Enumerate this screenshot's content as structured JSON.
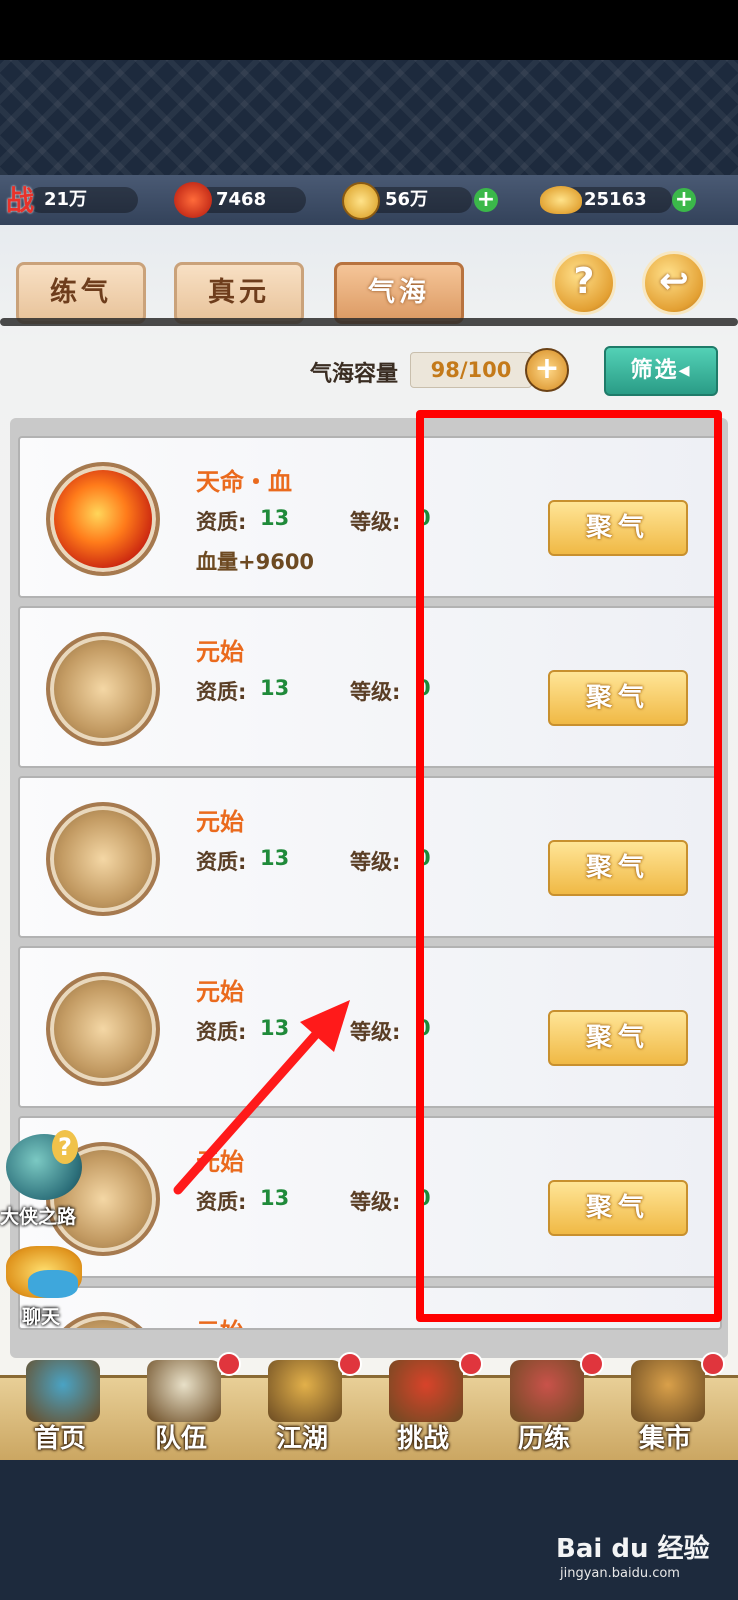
{
  "resources": [
    {
      "icon": "battle-power-icon",
      "glyph": "战",
      "value": "21万"
    },
    {
      "icon": "blood-orb-icon",
      "value": "7468"
    },
    {
      "icon": "coin-icon",
      "value": "56万"
    },
    {
      "icon": "gold-ingot-icon",
      "value": "25163"
    }
  ],
  "tabs": [
    "练气",
    "真元",
    "气海"
  ],
  "active_tab": "气海",
  "help_glyph": "?",
  "back_glyph": "↩",
  "capacity": {
    "label": "气海容量",
    "value": "98/100",
    "plus": "+"
  },
  "filter_label": "筛选◂",
  "items": [
    {
      "name": "天命・血",
      "quality_label": "资质:",
      "quality": "13",
      "level_label": "等级:",
      "level": "0",
      "attr": "血量+9600",
      "button": "聚气",
      "orb": "red"
    },
    {
      "name": "元始",
      "quality_label": "资质:",
      "quality": "13",
      "level_label": "等级:",
      "level": "0",
      "attr": "",
      "button": "聚气",
      "orb": "gold"
    },
    {
      "name": "元始",
      "quality_label": "资质:",
      "quality": "13",
      "level_label": "等级:",
      "level": "0",
      "attr": "",
      "button": "聚气",
      "orb": "gold"
    },
    {
      "name": "元始",
      "quality_label": "资质:",
      "quality": "13",
      "level_label": "等级:",
      "level": "0",
      "attr": "",
      "button": "聚气",
      "orb": "gold"
    },
    {
      "name": "元始",
      "quality_label": "资质:",
      "quality": "13",
      "level_label": "等级:",
      "level": "0",
      "attr": "",
      "button": "聚气",
      "orb": "gold"
    },
    {
      "name": "元始",
      "quality_label": "",
      "quality": "",
      "level_label": "",
      "level": "",
      "attr": "",
      "button": "",
      "orb": "gold"
    }
  ],
  "side": [
    {
      "label": "大侠之路",
      "icon": "hero-path-icon"
    },
    {
      "label": "聊天",
      "icon": "chat-icon"
    }
  ],
  "nav": [
    {
      "label": "首页",
      "icon": "home-icon"
    },
    {
      "label": "队伍",
      "icon": "team-icon"
    },
    {
      "label": "江湖",
      "icon": "gourd-icon"
    },
    {
      "label": "挑战",
      "icon": "lion-mask-icon"
    },
    {
      "label": "历练",
      "icon": "training-icon"
    },
    {
      "label": "集市",
      "icon": "market-icon"
    }
  ],
  "watermark": {
    "brand": "Bai du 经验",
    "url": "jingyan.baidu.com"
  },
  "colors": {
    "highlight": "#ff0000",
    "active_tab": "#dc9a63",
    "button": "#f0b945",
    "filter": "#2a9c86"
  }
}
